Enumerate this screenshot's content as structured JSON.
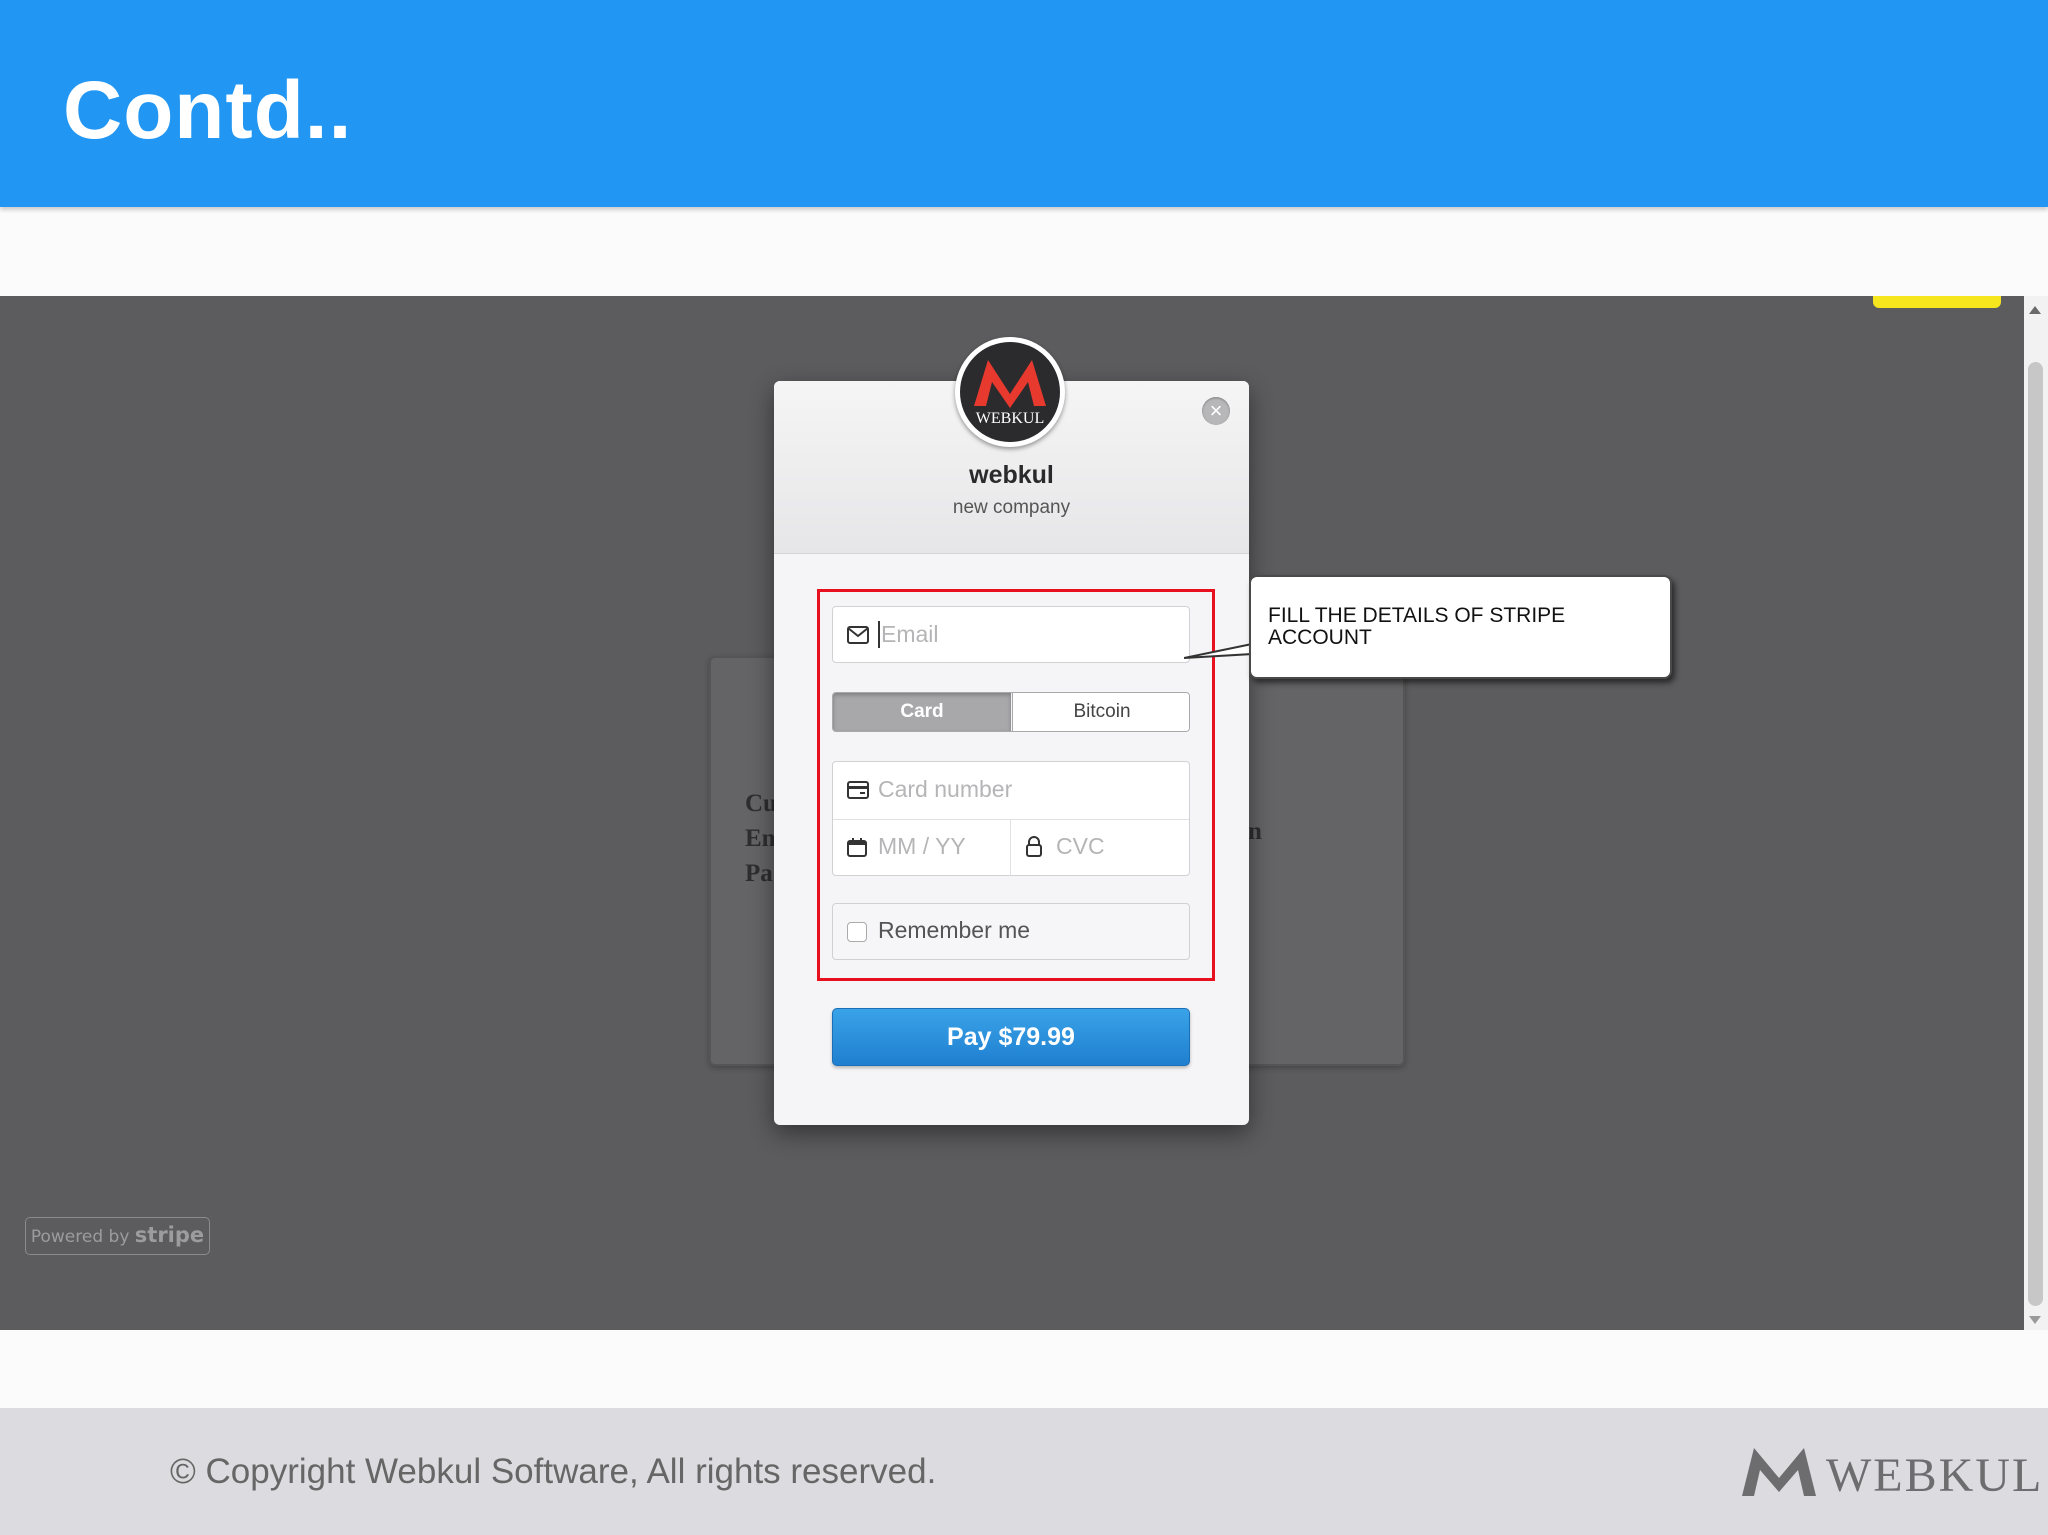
{
  "slide": {
    "title": "Contd..",
    "copyright": "© Copyright Webkul Software, All rights reserved.",
    "footer_logo_text": "WEBKUL"
  },
  "background_page": {
    "text_lines": [
      "Cu",
      "En",
      "Pa"
    ],
    "text_right": "n",
    "powered_by": "Powered by",
    "powered_brand": "stripe"
  },
  "checkout": {
    "logo_caption": "WEBKUL",
    "company_name": "webkul",
    "company_sub": "new company",
    "email_placeholder": "Email",
    "tabs": [
      {
        "label": "Card",
        "selected": true
      },
      {
        "label": "Bitcoin",
        "selected": false
      }
    ],
    "card_number_placeholder": "Card number",
    "expiry_placeholder": "MM / YY",
    "cvc_placeholder": "CVC",
    "remember_label": "Remember me",
    "remember_checked": false,
    "pay_label": "Pay $79.99"
  },
  "callout": {
    "text": "FILL THE DETAILS OF STRIPE ACCOUNT"
  },
  "colors": {
    "header_blue": "#2196f3",
    "highlight_red": "#e8101e",
    "pay_blue": "#2a90dc",
    "test_badge_yellow": "#f5e61d"
  },
  "icons": {
    "email": "envelope-icon",
    "card": "credit-card-icon",
    "expiry": "calendar-icon",
    "cvc": "lock-icon",
    "close": "close-icon"
  }
}
